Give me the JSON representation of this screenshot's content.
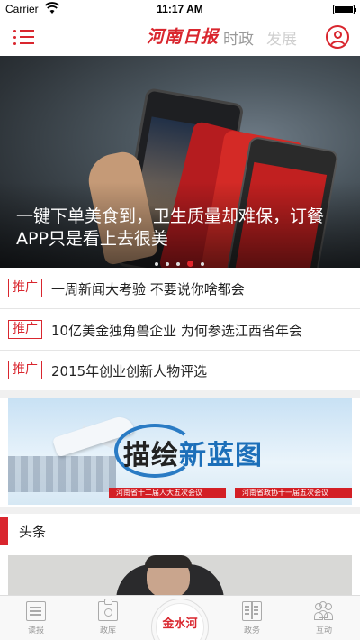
{
  "status_bar": {
    "carrier": "Carrier",
    "time": "11:17 AM"
  },
  "header": {
    "logo": "河南日报",
    "tabs": [
      "时政",
      "发展"
    ]
  },
  "hero": {
    "caption": "一键下单美食到，卫生质量却难保，订餐APP只是看上去很美",
    "dots": 5,
    "active_dot": 3
  },
  "promos": [
    {
      "badge": "推广",
      "text": "一周新闻大考验 不要说你啥都会"
    },
    {
      "badge": "推广",
      "text": "10亿美金独角兽企业 为何参选江西省年会"
    },
    {
      "badge": "推广",
      "text": "2015年创业创新人物评选"
    }
  ],
  "banner": {
    "title_dark": "描绘",
    "title_blue": "新蓝图",
    "ribbon_left": "河南省十二届人大五次会议",
    "ribbon_right": "河南省政协十一届五次会议"
  },
  "section": {
    "label": "头条"
  },
  "tabbar": {
    "items": [
      "读报",
      "政库",
      "政务",
      "互动"
    ],
    "center": "金水河"
  },
  "colors": {
    "accent": "#d9262e"
  }
}
